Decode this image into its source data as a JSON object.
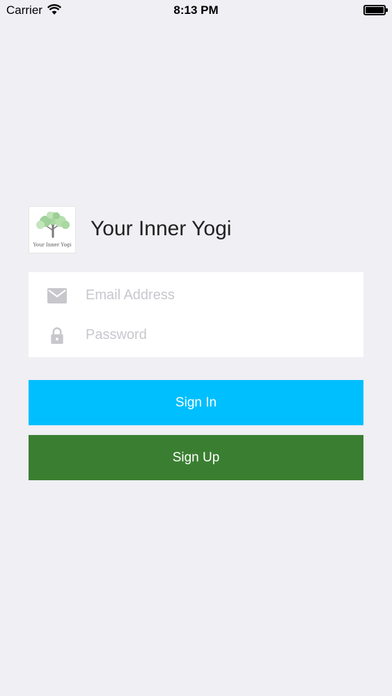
{
  "status_bar": {
    "carrier": "Carrier",
    "time": "8:13 PM",
    "icons": [
      "wifi-icon",
      "battery-icon"
    ]
  },
  "header": {
    "logo_text": "Your Inner Yogi",
    "title": "Your Inner Yogi"
  },
  "form": {
    "email": {
      "placeholder": "Email Address",
      "value": "",
      "icon": "mail-icon"
    },
    "password": {
      "placeholder": "Password",
      "value": "",
      "icon": "lock-icon"
    }
  },
  "buttons": {
    "sign_in": "Sign In",
    "sign_up": "Sign Up"
  },
  "colors": {
    "background": "#efeff4",
    "sign_in": "#00bfff",
    "sign_up": "#3a7f31",
    "icon_gray": "#c8c8cc"
  }
}
